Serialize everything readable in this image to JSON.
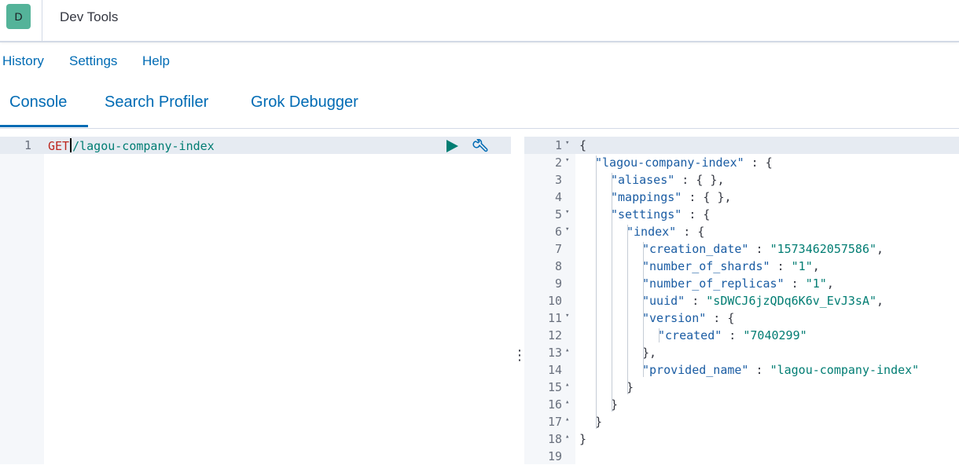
{
  "header": {
    "logo_letter": "D",
    "title": "Dev Tools"
  },
  "topnav": {
    "history": "History",
    "settings": "Settings",
    "help": "Help"
  },
  "tabs": [
    {
      "label": "Console",
      "active": true
    },
    {
      "label": "Search Profiler",
      "active": false
    },
    {
      "label": "Grok Debugger",
      "active": false
    }
  ],
  "request_editor": {
    "line_number": "1",
    "method": "GET",
    "path": "/lagou-company-index",
    "run_icon": "play-icon",
    "settings_icon": "wrench-icon"
  },
  "response_editor": {
    "lines": [
      {
        "n": "1",
        "fold": "▾",
        "text": "{"
      },
      {
        "n": "2",
        "fold": "▾",
        "text": "\"lagou-company-index\" : {"
      },
      {
        "n": "3",
        "fold": "",
        "text": "\"aliases\" : { },"
      },
      {
        "n": "4",
        "fold": "",
        "text": "\"mappings\" : { },"
      },
      {
        "n": "5",
        "fold": "▾",
        "text": "\"settings\" : {"
      },
      {
        "n": "6",
        "fold": "▾",
        "text": "\"index\" : {"
      },
      {
        "n": "7",
        "fold": "",
        "text": "\"creation_date\" : \"1573462057586\","
      },
      {
        "n": "8",
        "fold": "",
        "text": "\"number_of_shards\" : \"1\","
      },
      {
        "n": "9",
        "fold": "",
        "text": "\"number_of_replicas\" : \"1\","
      },
      {
        "n": "10",
        "fold": "",
        "text": "\"uuid\" : \"sDWCJ6jzQDq6K6v_EvJ3sA\","
      },
      {
        "n": "11",
        "fold": "▾",
        "text": "\"version\" : {"
      },
      {
        "n": "12",
        "fold": "",
        "text": "\"created\" : \"7040299\""
      },
      {
        "n": "13",
        "fold": "▴",
        "text": "},"
      },
      {
        "n": "14",
        "fold": "",
        "text": "\"provided_name\" : \"lagou-company-index\""
      },
      {
        "n": "15",
        "fold": "▴",
        "text": "}"
      },
      {
        "n": "16",
        "fold": "▴",
        "text": "}"
      },
      {
        "n": "17",
        "fold": "▴",
        "text": "}"
      },
      {
        "n": "18",
        "fold": "▴",
        "text": "}"
      },
      {
        "n": "19",
        "fold": "",
        "text": ""
      }
    ]
  },
  "colors": {
    "accent": "#006bb4",
    "logo_bg": "#54b399",
    "string": "#017d73",
    "method": "#bd271e"
  }
}
